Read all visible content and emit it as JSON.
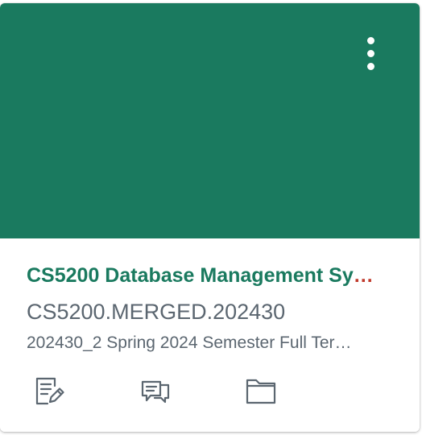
{
  "card": {
    "color": "#1a7a5f",
    "title": "CS5200 Database Management Sy…",
    "code": "CS5200.MERGED.202430",
    "term": "202430_2 Spring 2024 Semester Full Ter…",
    "menu_icon": "kebab-menu-icon",
    "actions": [
      {
        "icon": "assignments-icon"
      },
      {
        "icon": "discussions-icon"
      },
      {
        "icon": "files-folder-icon"
      }
    ]
  }
}
